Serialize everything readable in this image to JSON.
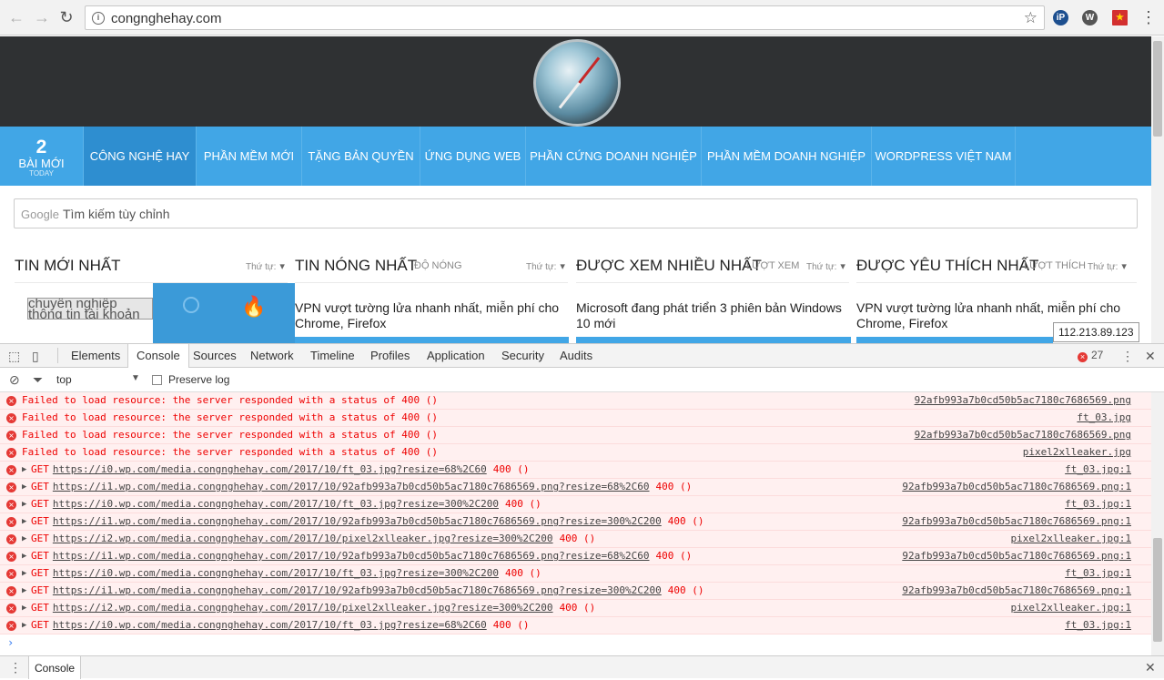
{
  "browser": {
    "url": "congnghehay.com",
    "extensions": [
      "ip-icon",
      "wordpress-icon",
      "vietnam-flag-icon"
    ]
  },
  "site": {
    "new_count": "2",
    "new_label": "BÀI MỚI",
    "new_sub": "TODAY",
    "nav": [
      "CÔNG NGHỆ HAY",
      "PHẦN MỀM MỚI",
      "TẶNG BẢN QUYỀN",
      "ỨNG DỤNG WEB",
      "PHẦN CỨNG DOANH NGHIỆP",
      "PHẦN MỀM DOANH NGHIỆP",
      "WORDPRESS VIỆT NAM"
    ],
    "search_brand": "Google",
    "search_placeholder": "Tìm kiếm tùy chỉnh",
    "sort_label": "Thứ tự:",
    "columns": [
      {
        "title": "TIN MỚI NHẤT",
        "sub": "",
        "post": "chuyên nghiệp thông tin tài khoản công nhân"
      },
      {
        "title": "TIN NÓNG NHẤT",
        "sub": "ĐỘ NÓNG",
        "post": "VPN vượt tường lửa nhanh nhất, miễn phí cho Chrome, Firefox"
      },
      {
        "title": "ĐƯỢC XEM NHIỀU NHẤT",
        "sub": "LƯỢT XEM",
        "post": "Microsoft đang phát triển 3 phiên bản Windows 10 mới"
      },
      {
        "title": "ĐƯỢC YÊU THÍCH NHẤT",
        "sub": "LƯỢT THÍCH",
        "post": "VPN vượt tường lửa nhanh nhất, miễn phí cho Chrome, Firefox"
      }
    ],
    "tooltip": "112.213.89.123"
  },
  "devtools": {
    "tabs": [
      "Elements",
      "Console",
      "Sources",
      "Network",
      "Timeline",
      "Profiles",
      "Application",
      "Security",
      "Audits"
    ],
    "active_tab": "Console",
    "error_count": "27",
    "context": "top",
    "preserve_log": "Preserve log",
    "drawer_tab": "Console",
    "messages": [
      {
        "kind": "fail",
        "text": "Failed to load resource: the server responded with a status of 400 ()",
        "source": "92afb993a7b0cd50b5ac7180c7686569.png"
      },
      {
        "kind": "fail",
        "text": "Failed to load resource: the server responded with a status of 400 ()",
        "source": "ft_03.jpg"
      },
      {
        "kind": "fail",
        "text": "Failed to load resource: the server responded with a status of 400 ()",
        "source": "92afb993a7b0cd50b5ac7180c7686569.png"
      },
      {
        "kind": "fail",
        "text": "Failed to load resource: the server responded with a status of 400 ()",
        "source": "pixel2xlleaker.jpg"
      },
      {
        "kind": "get",
        "method": "GET",
        "url": "https://i0.wp.com/media.congnghehay.com/2017/10/ft_03.jpg?resize=68%2C60",
        "status": "400 ()",
        "source": "ft_03.jpg:1"
      },
      {
        "kind": "get",
        "method": "GET",
        "url": "https://i1.wp.com/media.congnghehay.com/2017/10/92afb993a7b0cd50b5ac7180c7686569.png?resize=68%2C60",
        "status": "400 ()",
        "source": "92afb993a7b0cd50b5ac7180c7686569.png:1"
      },
      {
        "kind": "get",
        "method": "GET",
        "url": "https://i0.wp.com/media.congnghehay.com/2017/10/ft_03.jpg?resize=300%2C200",
        "status": "400 ()",
        "source": "ft_03.jpg:1"
      },
      {
        "kind": "get",
        "method": "GET",
        "url": "https://i1.wp.com/media.congnghehay.com/2017/10/92afb993a7b0cd50b5ac7180c7686569.png?resize=300%2C200",
        "status": "400 ()",
        "source": "92afb993a7b0cd50b5ac7180c7686569.png:1"
      },
      {
        "kind": "get",
        "method": "GET",
        "url": "https://i2.wp.com/media.congnghehay.com/2017/10/pixel2xlleaker.jpg?resize=300%2C200",
        "status": "400 ()",
        "source": "pixel2xlleaker.jpg:1"
      },
      {
        "kind": "get",
        "method": "GET",
        "url": "https://i1.wp.com/media.congnghehay.com/2017/10/92afb993a7b0cd50b5ac7180c7686569.png?resize=68%2C60",
        "status": "400 ()",
        "source": "92afb993a7b0cd50b5ac7180c7686569.png:1"
      },
      {
        "kind": "get",
        "method": "GET",
        "url": "https://i0.wp.com/media.congnghehay.com/2017/10/ft_03.jpg?resize=300%2C200",
        "status": "400 ()",
        "source": "ft_03.jpg:1"
      },
      {
        "kind": "get",
        "method": "GET",
        "url": "https://i1.wp.com/media.congnghehay.com/2017/10/92afb993a7b0cd50b5ac7180c7686569.png?resize=300%2C200",
        "status": "400 ()",
        "source": "92afb993a7b0cd50b5ac7180c7686569.png:1"
      },
      {
        "kind": "get",
        "method": "GET",
        "url": "https://i2.wp.com/media.congnghehay.com/2017/10/pixel2xlleaker.jpg?resize=300%2C200",
        "status": "400 ()",
        "source": "pixel2xlleaker.jpg:1"
      },
      {
        "kind": "get",
        "method": "GET",
        "url": "https://i0.wp.com/media.congnghehay.com/2017/10/ft_03.jpg?resize=68%2C60",
        "status": "400 ()",
        "source": "ft_03.jpg:1"
      }
    ]
  }
}
